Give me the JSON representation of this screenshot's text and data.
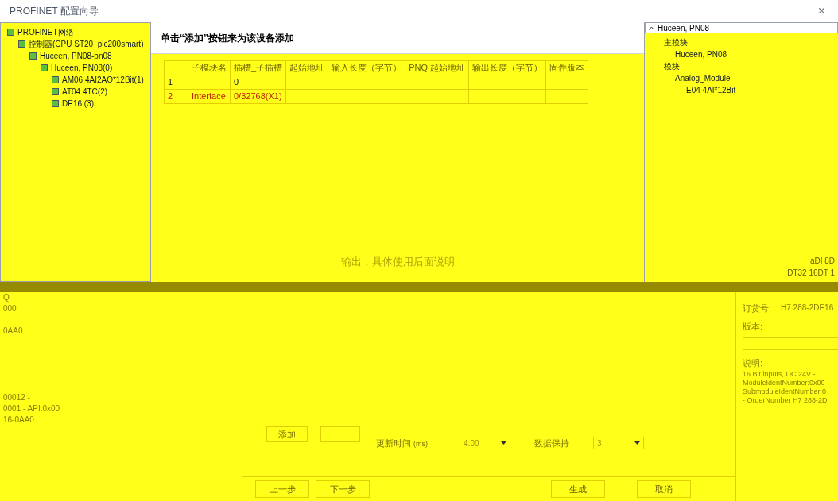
{
  "window": {
    "title": "PROFINET 配置向导",
    "close": "×"
  },
  "left_tree": {
    "items": [
      {
        "label": "PROFINET网络",
        "children": [
          {
            "label": "控制器(CPU ST20_plc200smart)",
            "children": [
              {
                "label": "Huceen, PN08-pn08",
                "children": [
                  {
                    "label": "Huceen, PN08(0)",
                    "children": [
                      {
                        "label": "AM06 4AI2AO*12Bit(1)"
                      },
                      {
                        "label": "AT04 4TC(2)"
                      },
                      {
                        "label": "DE16 (3)"
                      }
                    ]
                  }
                ]
              }
            ]
          }
        ]
      }
    ]
  },
  "instruction": "单击“添加”按钮来为该设备添加",
  "table": {
    "columns": [
      "",
      "子模块名",
      "插槽_子插槽",
      "起始地址",
      "输入长度（字节）",
      "PNQ 起始地址",
      "输出长度（字节）",
      "固件版本"
    ],
    "rows": [
      [
        "1",
        "",
        "0",
        "",
        "",
        "",
        "",
        ""
      ],
      [
        "2",
        "Interface",
        "0/32768(X1)",
        "",
        "",
        "",
        "",
        ""
      ]
    ]
  },
  "note": "输出，具体使用后面说明",
  "right_tree": {
    "device": "Huceen, PN08",
    "items": [
      {
        "label": "主模块",
        "children": [
          {
            "label": "Huceen, PN08"
          }
        ]
      },
      {
        "label": "模块",
        "children": [
          {
            "label": "Analog_Module",
            "children": [
              {
                "label": "E04 4AI*12Bit"
              }
            ]
          }
        ]
      }
    ],
    "more": [
      "aDI 8D",
      "DT32 16DT 1"
    ]
  },
  "left_info": {
    "lines": [
      "Q",
      "000",
      "0AA0",
      "00012 -",
      "0001 - API:0x00",
      "16-0AA0"
    ]
  },
  "settings": {
    "add_button": "添加",
    "update_label": "更新时间",
    "update_unit": "(ms)",
    "update_value": "4.00",
    "hold_label": "数据保持",
    "hold_value": "3"
  },
  "module_info": {
    "order_label": "订货号:",
    "order_value": "H7 288-2DE16",
    "version_label": "版本:",
    "desc_label": "说明:",
    "desc": [
      "16 Bit inputs, DC 24V -",
      "ModuleIdentNumber:0x00",
      "SubmoduleIdentNumber:0",
      "- OrderNumber H7 288-2D"
    ]
  },
  "footer": {
    "buttons": [
      "上一步",
      "下一步",
      "生成",
      "取消"
    ]
  }
}
